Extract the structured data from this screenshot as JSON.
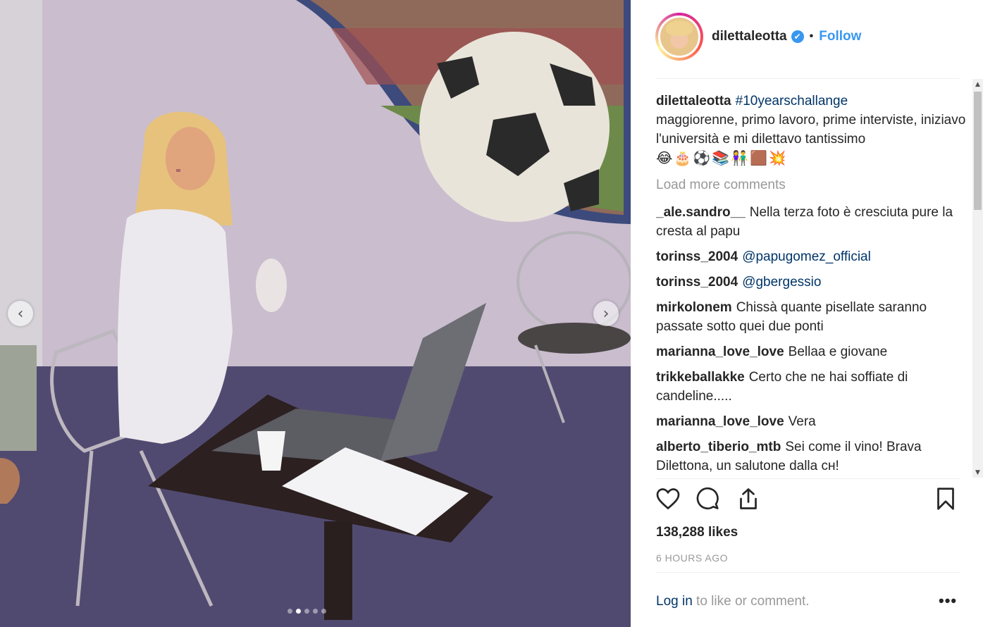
{
  "photo": {
    "prev_arrow": "‹",
    "next_arrow": "›",
    "carousel_count": 5,
    "carousel_active": 1
  },
  "post": {
    "username": "dilettaleotta",
    "verified_glyph": "✔",
    "separator": "•",
    "follow_label": "Follow",
    "caption": {
      "user": "dilettaleotta",
      "hashtag": "#10yearschallange",
      "text": "maggiorenne, primo lavoro, prime interviste, iniziavo l'università e mi dilettavo tantissimo",
      "emojis": "😂🎂⚽📚👫🟫💥"
    },
    "load_more": "Load more comments",
    "comments": [
      {
        "user": "_ale.sandro__",
        "text": "Nella terza foto è cresciuta pure la cresta al papu"
      },
      {
        "user": "torinss_2004",
        "mention": "@papugomez_official",
        "text": ""
      },
      {
        "user": "torinss_2004",
        "mention": "@gbergessio",
        "text": ""
      },
      {
        "user": "mirkolonem",
        "text": "Chissà quante pisellate saranno passate sotto quei due ponti"
      },
      {
        "user": "marianna_love_love",
        "text": "Bellaa e giovane"
      },
      {
        "user": "trikkeballakke",
        "text": "Certo che ne hai soffiate di candeline....."
      },
      {
        "user": "marianna_love_love",
        "text": "Vera"
      },
      {
        "user": "alberto_tiberio_mtb",
        "text": "Sei come il vino! Brava Dilettona, un salutone dalla ᴄʜ!"
      }
    ],
    "likes": "138,288 likes",
    "time": "6 HOURS AGO",
    "login_link": "Log in",
    "login_rest": " to like or comment.",
    "more_glyph": "•••"
  },
  "icons": {
    "like": "heart-icon",
    "comment": "comment-icon",
    "share": "share-icon",
    "save": "bookmark-icon"
  },
  "colors": {
    "link": "#003569",
    "follow": "#3897f0",
    "muted": "#999999",
    "text": "#262626"
  }
}
